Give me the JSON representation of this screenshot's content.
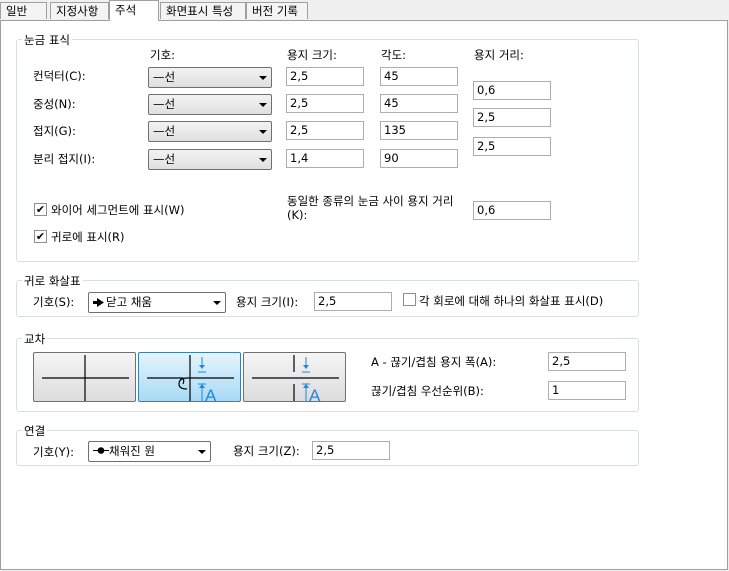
{
  "tabs": [
    {
      "label": "일반"
    },
    {
      "label": "지정사항"
    },
    {
      "label": "주석"
    },
    {
      "label": "화면표시 특성"
    },
    {
      "label": "버전 기록"
    }
  ],
  "tick_marks": {
    "title": "눈금 표식",
    "col_symbol": "기호:",
    "col_size": "용지 크기:",
    "col_angle": "각도:",
    "col_spacing": "용지 거리:",
    "rows": [
      {
        "label": "컨덕터(C):",
        "symbol": "—선",
        "size": "2,5",
        "angle": "45"
      },
      {
        "label": "중성(N):",
        "symbol": "—선",
        "size": "2,5",
        "angle": "45"
      },
      {
        "label": "접지(G):",
        "symbol": "—선",
        "size": "2,5",
        "angle": "135"
      },
      {
        "label": "분리 접지(I):",
        "symbol": "—선",
        "size": "1,4",
        "angle": "90"
      }
    ],
    "spacing_values": [
      "0,6",
      "2,5",
      "2,5"
    ],
    "show_on_wire_label": "와이어 세그먼트에 표시(W)",
    "show_on_wire_checked": true,
    "show_on_home_label": "귀로에 표시(R)",
    "show_on_home_checked": true,
    "same_type_spacing_label": "동일한 종류의 눈금 사이 용지 거리(K):",
    "same_type_spacing_value": "0,6"
  },
  "home_run": {
    "title": "귀로 화살표",
    "symbol_label": "기호(S):",
    "symbol_value": "닫고 채움",
    "size_label": "용지 크기(I):",
    "size_value": "2,5",
    "one_arrow_label": "각 회로에 대해 하나의 화살표 표시(D)",
    "one_arrow_checked": false
  },
  "crossing": {
    "title": "교차",
    "gap_width_label": "A - 끊기/겹침 용지 폭(A):",
    "gap_width_value": "2,5",
    "priority_label": "끊기/겹침 우선순위(B):",
    "priority_value": "1",
    "gap_glyph": "A"
  },
  "connection": {
    "title": "연결",
    "symbol_label": "기호(Y):",
    "symbol_value": "채워진 원",
    "size_label": "용지 크기(Z):",
    "size_value": "2,5"
  }
}
